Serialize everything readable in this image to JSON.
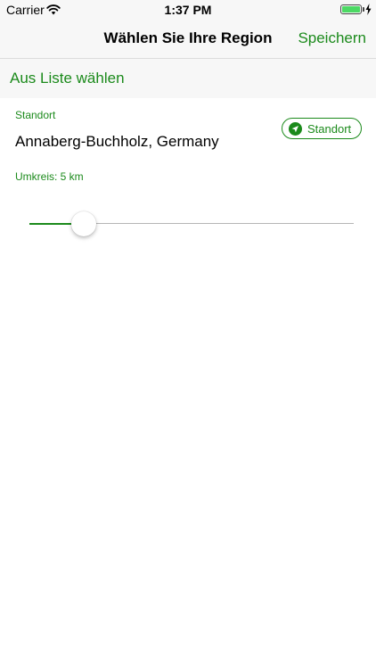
{
  "status_bar": {
    "carrier": "Carrier",
    "time": "1:37 PM",
    "icons": [
      "wifi-icon",
      "battery-icon",
      "charging-bolt-icon"
    ]
  },
  "nav": {
    "title": "Wählen Sie Ihre Region",
    "save_label": "Speichern"
  },
  "list_link": "Aus Liste wählen",
  "location": {
    "label": "Standort",
    "value": "Annaberg-Buchholz, Germany",
    "button_label": "Standort",
    "button_icon": "location-arrow-icon"
  },
  "radius": {
    "label": "Umkreis: 5 km",
    "slider_fraction": 0.167
  },
  "colors": {
    "accent": "#1b8a1b",
    "bar_background": "#f7f7f7",
    "battery": "#4cd964"
  }
}
